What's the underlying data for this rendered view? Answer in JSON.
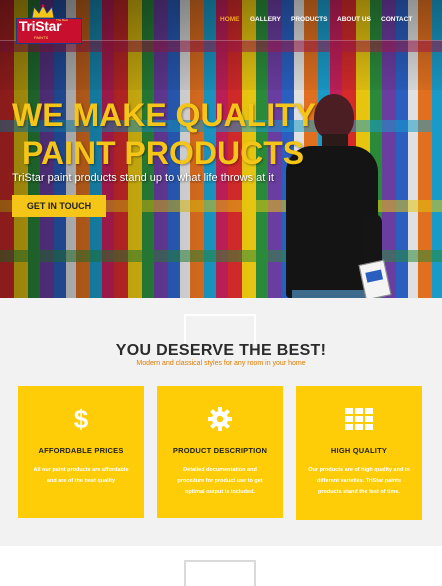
{
  "brand": {
    "name": "TriStar",
    "sub": "PAINTS",
    "tagline": "The Best",
    "colors": {
      "accent": "#f5c518",
      "brand_red": "#c8102e",
      "nav_active": "#f5a623",
      "card_bg": "#fecd08",
      "subtitle": "#e07b00"
    }
  },
  "nav": {
    "items": [
      {
        "label": "HOME",
        "active": true
      },
      {
        "label": "GALLERY",
        "active": false
      },
      {
        "label": "PRODUCTS",
        "active": false
      },
      {
        "label": "ABOUT US",
        "active": false
      },
      {
        "label": "CONTACT",
        "active": false
      }
    ]
  },
  "hero": {
    "title_line1": "WE MAKE QUALITY",
    "title_line2": "PAINT PRODUCTS",
    "subtitle": "TriStar paint products stand up to what life throws at it",
    "cta_label": "GET IN TOUCH"
  },
  "features": {
    "title": "YOU DESERVE THE BEST!",
    "subtitle": "Modern and classical styles for any room in your home",
    "cards": [
      {
        "icon": "dollar-icon",
        "title": "AFFORDABLE PRICES",
        "text": "All our paint products are affordable and are of the best quality"
      },
      {
        "icon": "gear-icon",
        "title": "PRODUCT DESCRIPTION",
        "text": "Detailed documentation and procedure for product use to get optimal output is included."
      },
      {
        "icon": "grid-icon",
        "title": "HIGH QUALITY",
        "text": "Our products are of high quality and in different varieties. TriStar paints products stand the test of time."
      }
    ]
  }
}
